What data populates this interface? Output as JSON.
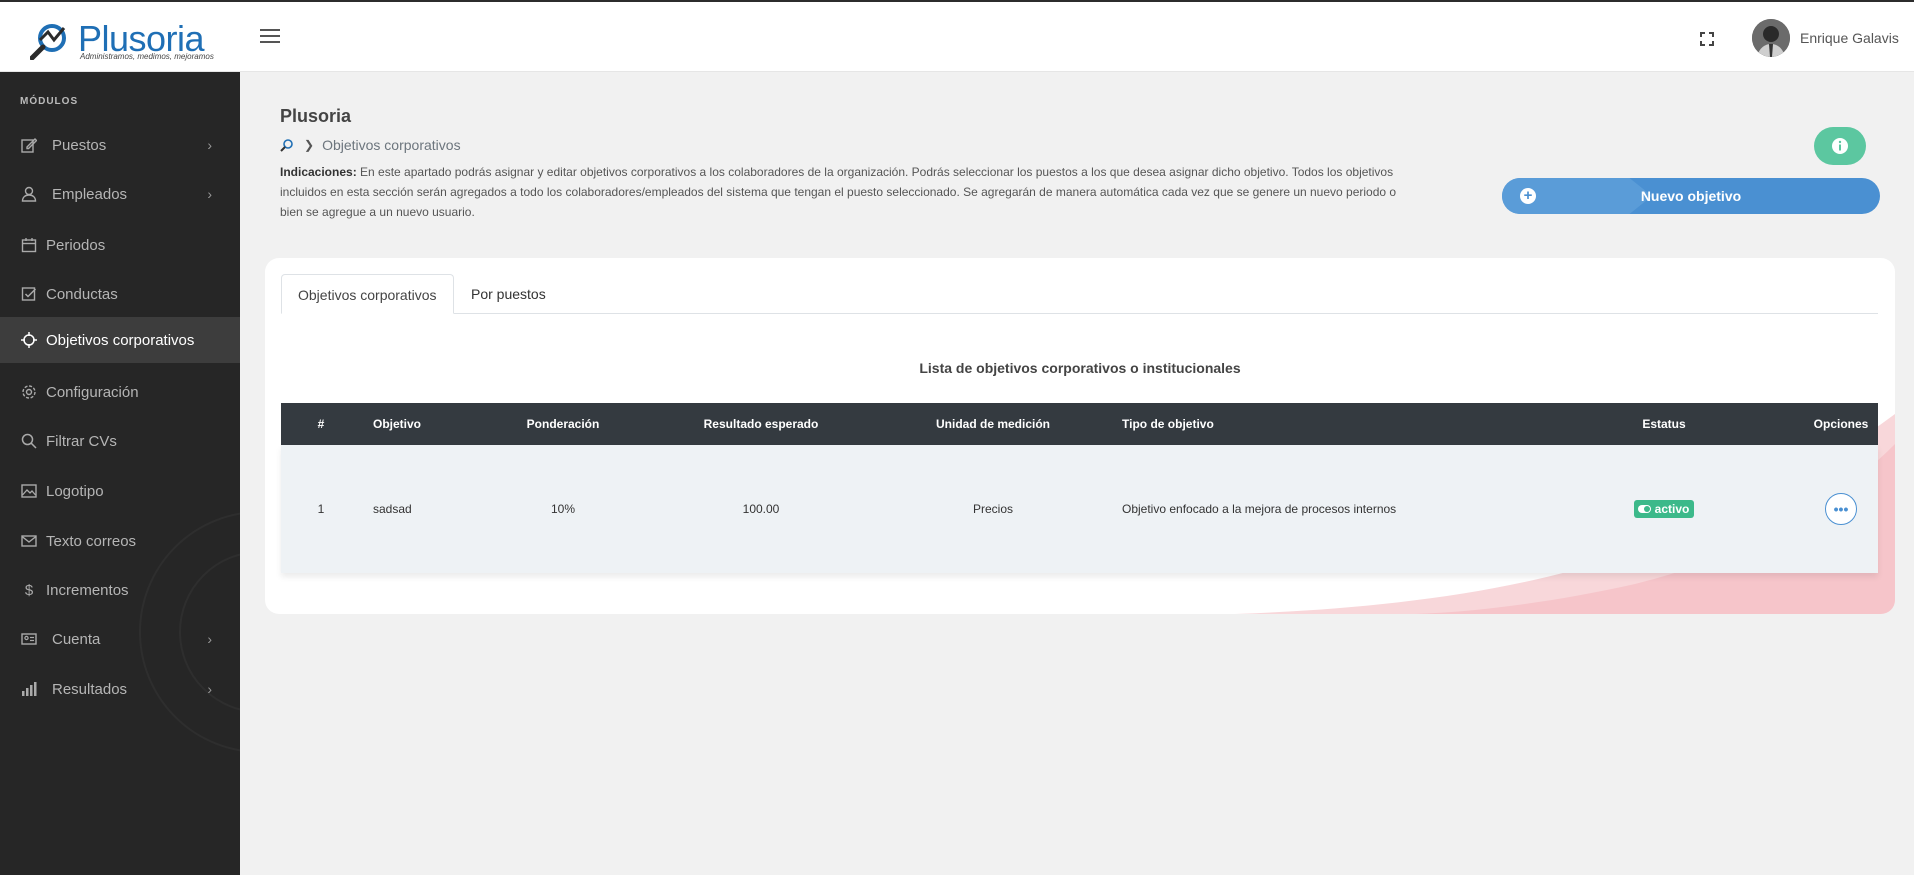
{
  "header": {
    "logo_text": "Plusoria",
    "logo_tagline": "Administramos, medimos, mejoramos",
    "menu_icon": "hamburger-icon",
    "fullscreen_icon": "fullscreen-icon",
    "user_name": "Enrique Galavis"
  },
  "sidebar": {
    "section_title": "MÓDULOS",
    "items": [
      {
        "label": "Puestos",
        "icon": "edit-icon",
        "has_children": true
      },
      {
        "label": "Empleados",
        "icon": "user-icon",
        "has_children": true
      },
      {
        "label": "Periodos",
        "icon": "calendar-icon",
        "has_children": false
      },
      {
        "label": "Conductas",
        "icon": "checkbox-icon",
        "has_children": false
      },
      {
        "label": "Objetivos corporativos",
        "icon": "crosshair-icon",
        "has_children": false,
        "active": true
      },
      {
        "label": "Configuración",
        "icon": "gear-icon",
        "has_children": false
      },
      {
        "label": "Filtrar CVs",
        "icon": "search-icon",
        "has_children": false
      },
      {
        "label": "Logotipo",
        "icon": "image-icon",
        "has_children": false
      },
      {
        "label": "Texto correos",
        "icon": "mail-icon",
        "has_children": false
      },
      {
        "label": "Incrementos",
        "icon": "dollar-icon",
        "has_children": false
      },
      {
        "label": "Cuenta",
        "icon": "id-card-icon",
        "has_children": true
      },
      {
        "label": "Resultados",
        "icon": "bar-chart-icon",
        "has_children": true
      }
    ]
  },
  "page": {
    "title": "Plusoria",
    "breadcrumb_current": "Objetivos corporativos",
    "indications_label": "Indicaciones:",
    "indications_text": " En este apartado podrás asignar y editar objetivos corporativos a los colaboradores de la organización. Podrás seleccionar los puestos a los que desea asignar dicho objetivo. Todos los objetivos incluidos en esta sección serán agregados a todo los colaboradores/empleados del sistema que tengan el puesto seleccionado. Se agregarán de manera automática cada vez que se genere un nuevo periodo o bien se agregue a un nuevo usuario.",
    "new_button_label": "Nuevo objetivo",
    "colors": {
      "accent_blue": "#4a90d2",
      "accent_green": "#3cb98a",
      "sidebar_bg": "#262626",
      "table_header_bg": "#343a40"
    }
  },
  "tabs": [
    "Objetivos corporativos",
    "Por puestos"
  ],
  "table": {
    "title": "Lista de objetivos corporativos o institucionales",
    "columns": [
      "#",
      "Objetivo",
      "Ponderación",
      "Resultado esperado",
      "Unidad de medición",
      "Tipo de objetivo",
      "Estatus",
      "Opciones"
    ],
    "rows": [
      {
        "num": "1",
        "objetivo": "sadsad",
        "ponderacion": "10%",
        "resultado": "100.00",
        "unidad": "Precios",
        "tipo": "Objetivo enfocado a la mejora de procesos internos",
        "estatus": "activo",
        "opciones": "•••"
      }
    ]
  }
}
